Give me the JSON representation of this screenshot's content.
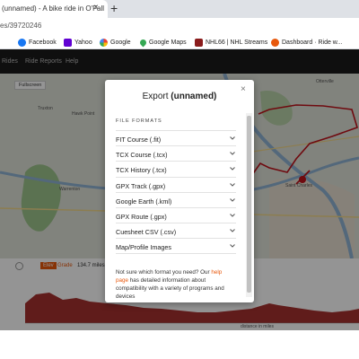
{
  "browser": {
    "tab_title": "(unnamed) - A bike ride in O'Fall",
    "tab_close": "×",
    "new_tab": "+",
    "url": "es/39720246"
  },
  "bookmarks": [
    {
      "label": "Facebook",
      "icon": "facebook-icon",
      "color": "#1877f2"
    },
    {
      "label": "Yahoo",
      "icon": "yahoo-icon",
      "color": "#6001d2"
    },
    {
      "label": "Google",
      "icon": "google-icon",
      "color": "#4285f4"
    },
    {
      "label": "Google Maps",
      "icon": "google-maps-icon",
      "color": "#34a853"
    },
    {
      "label": "NHL66 | NHL Streams",
      "icon": "nhl66-icon",
      "color": "#8a1c1c"
    },
    {
      "label": "Dashboard · Ride w...",
      "icon": "ride-with-gps-icon",
      "color": "#e8580c"
    }
  ],
  "app_nav": [
    "Rides",
    "Ride Reports",
    "Help"
  ],
  "map": {
    "fullscreen_label": "Fullscreen",
    "place_labels": [
      "Truxton",
      "Hawk Point",
      "Warrenton",
      "Marthasville",
      "Augusta",
      "Washington",
      "Grafton",
      "Alton",
      "Edwardsville",
      "Saint Charles",
      "Otterville",
      "St. Peters",
      "Wentzville"
    ]
  },
  "elevation": {
    "toggle_label": "Elev",
    "grade_label": "Grade",
    "distance": "134.7 miles",
    "x_axis_label": "distance in miles",
    "x_ticks": [
      "0",
      "5",
      "10",
      "15",
      "20",
      "25",
      "30",
      "35",
      "40",
      "45",
      "50",
      "55",
      "60",
      "65",
      "70",
      "75",
      "80",
      "85",
      "90",
      "95",
      "100",
      "105",
      "110",
      "115",
      "120",
      "125",
      "130"
    ]
  },
  "modal": {
    "title_prefix": "Export ",
    "title_name": "(unnamed)",
    "close": "×",
    "section_label": "FILE FORMATS",
    "formats": [
      "FIT Course (.fit)",
      "TCX Course (.tcx)",
      "TCX History (.tcx)",
      "GPX Track (.gpx)",
      "Google Earth (.kml)",
      "GPX Route (.gpx)",
      "Cuesheet CSV (.csv)",
      "Map/Profile Images"
    ],
    "help_before": "Not sure which format you need? Our ",
    "help_link": "help page",
    "help_after": " has detailed information about compatibility with a variety of programs and devices"
  },
  "colors": {
    "route": "#c0121b",
    "accent": "#e8580c",
    "river": "#8fb3d4",
    "elevation_fill": "#a6312f"
  }
}
